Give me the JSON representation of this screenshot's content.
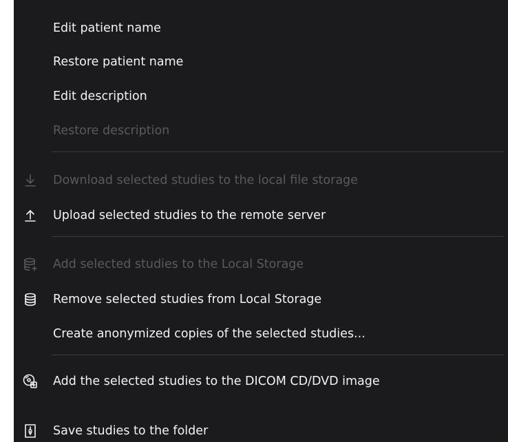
{
  "context_menu": {
    "items": [
      {
        "label": "Edit patient name",
        "enabled": true
      },
      {
        "label": "Restore patient name",
        "enabled": true
      },
      {
        "label": "Edit description",
        "enabled": true
      },
      {
        "label": "Restore description",
        "enabled": false
      },
      {
        "label": "Download selected studies to the local file storage",
        "enabled": false,
        "icon": "download-icon"
      },
      {
        "label": "Upload selected studies to the remote server",
        "enabled": true,
        "icon": "upload-icon"
      },
      {
        "label": "Add selected studies to the Local Storage",
        "enabled": false,
        "icon": "database-add-icon"
      },
      {
        "label": "Remove selected studies from Local Storage",
        "enabled": true,
        "icon": "database-icon"
      },
      {
        "label": "Create anonymized copies of the selected studies...",
        "enabled": true
      },
      {
        "label": "Add the selected studies to the DICOM CD/DVD image",
        "enabled": true,
        "icon": "disc-icon"
      },
      {
        "label": "Save studies to the folder",
        "enabled": true,
        "icon": "save-to-folder-icon"
      }
    ]
  },
  "colors": {
    "menu_background": "#1b1b1d",
    "enabled_text": "#f3f3f3",
    "disabled_text": "#5a5a5e",
    "separator": "#3c3c40"
  }
}
